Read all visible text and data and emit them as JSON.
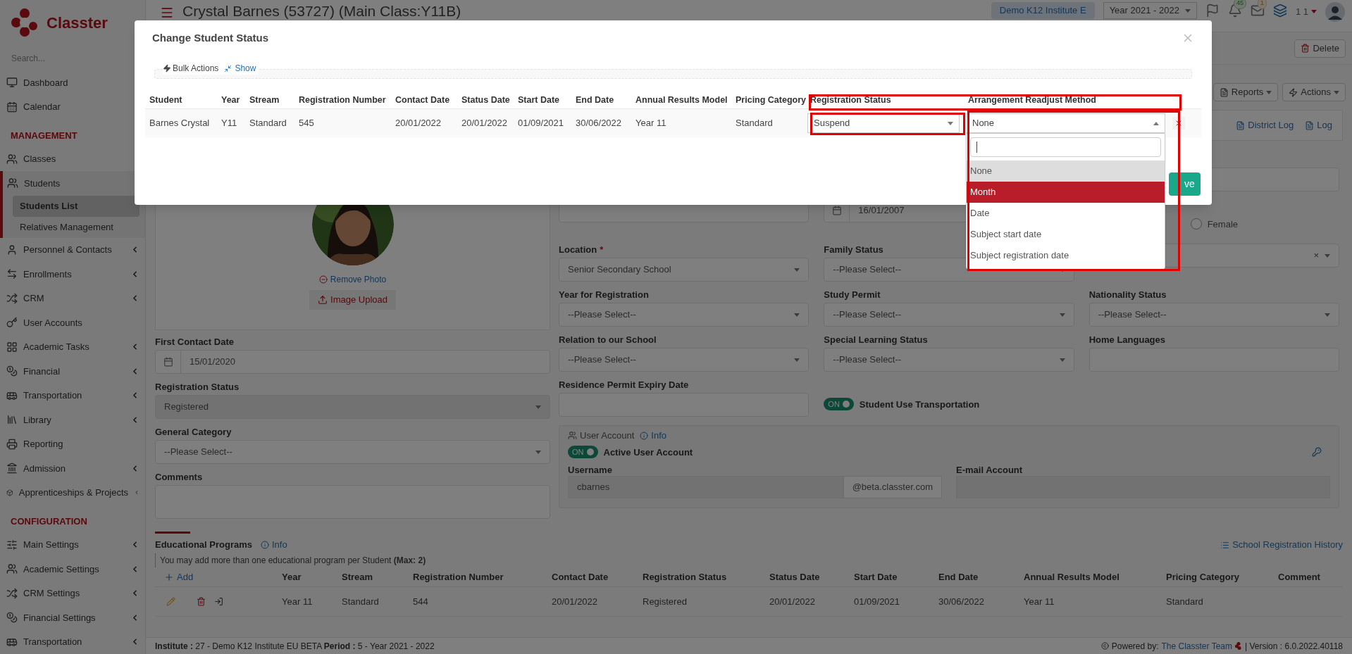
{
  "brand": {
    "name": "Classter",
    "search_placeholder": "Search..."
  },
  "sidebar": [
    {
      "kind": "link",
      "label": "Dashboard",
      "submenu": false
    },
    {
      "kind": "link",
      "label": "Calendar",
      "submenu": false
    },
    {
      "kind": "heading",
      "label": "MANAGEMENT"
    },
    {
      "kind": "link",
      "label": "Classes",
      "submenu": false
    },
    {
      "kind": "link",
      "label": "Students",
      "submenu": false,
      "expanded": true,
      "children": [
        {
          "label": "Students List",
          "selected": true
        },
        {
          "label": "Relatives Management",
          "selected": false
        }
      ]
    },
    {
      "kind": "link",
      "label": "Personnel & Contacts",
      "submenu": true
    },
    {
      "kind": "link",
      "label": "Enrollments",
      "submenu": true
    },
    {
      "kind": "link",
      "label": "CRM",
      "submenu": true
    },
    {
      "kind": "link",
      "label": "User Accounts",
      "submenu": false
    },
    {
      "kind": "link",
      "label": "Academic Tasks",
      "submenu": true
    },
    {
      "kind": "link",
      "label": "Financial",
      "submenu": true
    },
    {
      "kind": "link",
      "label": "Transportation",
      "submenu": true
    },
    {
      "kind": "link",
      "label": "Library",
      "submenu": true
    },
    {
      "kind": "link",
      "label": "Reporting",
      "submenu": false
    },
    {
      "kind": "link",
      "label": "Admission",
      "submenu": true
    },
    {
      "kind": "link",
      "label": "Apprenticeships & Projects",
      "submenu": true
    },
    {
      "kind": "heading",
      "label": "CONFIGURATION"
    },
    {
      "kind": "link",
      "label": "Main Settings",
      "submenu": true
    },
    {
      "kind": "link",
      "label": "Academic Settings",
      "submenu": true
    },
    {
      "kind": "link",
      "label": "CRM Settings",
      "submenu": true
    },
    {
      "kind": "link",
      "label": "Financial Settings",
      "submenu": true
    },
    {
      "kind": "link",
      "label": "Transportation",
      "submenu": true
    }
  ],
  "topbar": {
    "title": "Crystal Barnes (53727) (Main Class:Y11B)",
    "institute": "Demo K12 Institute E",
    "year": "Year 2021 - 2022",
    "notifications": "45",
    "messages": "1",
    "user": "1 1"
  },
  "page_actions": {
    "delete": "Delete",
    "reports": "Reports",
    "actions": "Actions",
    "district_log": "District Log",
    "log": "Log"
  },
  "photo": {
    "remove": "Remove Photo",
    "upload": "Image Upload"
  },
  "left_fields": [
    {
      "kind": "date",
      "label": "First Contact Date",
      "value": "15/01/2020"
    },
    {
      "kind": "select",
      "label": "Registration Status",
      "value": "Registered",
      "disabled": true
    },
    {
      "kind": "select",
      "label": "General Category",
      "placeholder": "--Please Select--",
      "disabled": false
    },
    {
      "kind": "textarea",
      "label": "Comments"
    }
  ],
  "grid_rows": [
    [
      {
        "kind": "blank"
      },
      {
        "kind": "blank"
      },
      {
        "kind": "input"
      }
    ],
    [
      {
        "kind": "input"
      },
      {
        "kind": "date",
        "value": "16/01/2007"
      },
      {
        "kind": "radio",
        "label": "Female",
        "selected": false
      }
    ],
    [
      {
        "kind": "select",
        "label": "Location",
        "required_mark": "*",
        "value": "Senior Secondary School"
      },
      {
        "kind": "select",
        "label": "Family Status",
        "placeholder": "--Please Select--"
      },
      {
        "kind": "select",
        "clear": "×"
      }
    ],
    [
      {
        "kind": "select",
        "label": "Year for Registration",
        "placeholder": "--Please Select--"
      },
      {
        "kind": "select",
        "label": "Study Permit",
        "placeholder": "--Please Select--"
      },
      {
        "kind": "select",
        "label": "Nationality Status",
        "placeholder": "--Please Select--"
      }
    ],
    [
      {
        "kind": "select",
        "label": "Relation to our School",
        "placeholder": "--Please Select--"
      },
      {
        "kind": "select",
        "label": "Special Learning Status",
        "placeholder": "--Please Select--"
      },
      {
        "kind": "input",
        "label": "Home Languages"
      }
    ],
    [
      {
        "kind": "input",
        "label": "Residence Permit Expiry Date"
      },
      {
        "kind": "toggle",
        "label": "Student Use Transportation",
        "on": true,
        "on_text": "ON"
      },
      {
        "kind": "blank"
      }
    ]
  ],
  "user_account": {
    "legend": "User Account",
    "info": "Info",
    "toggle": {
      "label": "Active User Account",
      "on": true,
      "on_text": "ON"
    },
    "username_label": "Username",
    "username": "cbarnes",
    "domain": "@beta.classter.com",
    "email_label": "E-mail Account"
  },
  "education": {
    "title": "Educational Programs",
    "info": "Info",
    "history": "School Registration History",
    "note": "You may add more than one educational program per Student **(Max: 2)**",
    "add": "Add",
    "columns": [
      "Year",
      "Stream",
      "Registration Number",
      "Contact Date",
      "Registration Status",
      "Status Date",
      "Start Date",
      "End Date",
      "Annual Results Model",
      "Pricing Category",
      "Comment"
    ],
    "rows": [
      {
        "cells": [
          "Year 11",
          "Standard",
          "544",
          "20/01/2022",
          "Registered",
          "20/01/2022",
          "01/09/2021",
          "30/06/2022",
          "Year 11",
          "Standard"
        ]
      }
    ]
  },
  "footer": {
    "left": "**Institute :** 27 - Demo K12 Institute EU BETA **Period :** 5 - Year 2021 - 2022",
    "powered": "Powered by:",
    "team": "The Classter Team",
    "version": "| Version : 6.0.2022.40118"
  },
  "modal": {
    "title": "Change Student Status",
    "bulk_label": "Bulk Actions",
    "bulk_link": "Show",
    "columns": [
      "Student",
      "Year",
      "Stream",
      "Registration Number",
      "Contact Date",
      "Status Date",
      "Start Date",
      "End Date",
      "Annual Results Model",
      "Pricing Category",
      "Registration Status",
      "Arrangement Readjust Method"
    ],
    "rows": [
      {
        "cells": [
          "Barnes Crystal",
          "Y11",
          "Standard",
          "545",
          "20/01/2022",
          "20/01/2022",
          "01/09/2021",
          "30/06/2022",
          "Year 11",
          "Standard"
        ],
        "registration_status": "Suspend",
        "arrangement": {
          "value": "None",
          "expanded": true,
          "options": [
            {
              "label": "None",
              "selected": true,
              "highlighted": false
            },
            {
              "label": "Month",
              "selected": false,
              "highlighted": true
            },
            {
              "label": "Date",
              "selected": false,
              "highlighted": false
            },
            {
              "label": "Subject start date",
              "selected": false,
              "highlighted": false
            },
            {
              "label": "Subject registration date",
              "selected": false,
              "highlighted": false
            }
          ]
        }
      }
    ],
    "save": "ve"
  }
}
